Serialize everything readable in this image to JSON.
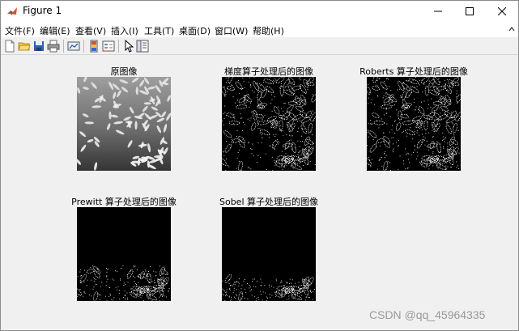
{
  "window": {
    "title": "Figure 1",
    "controls": {
      "minimize": "minimize",
      "maximize": "maximize",
      "close": "close"
    }
  },
  "menubar": {
    "items": [
      {
        "label": "文件(F)"
      },
      {
        "label": "编辑(E)"
      },
      {
        "label": "查看(V)"
      },
      {
        "label": "插入(I)"
      },
      {
        "label": "工具(T)"
      },
      {
        "label": "桌面(D)"
      },
      {
        "label": "窗口(W)"
      },
      {
        "label": "帮助(H)"
      }
    ]
  },
  "toolbar": {
    "buttons": [
      {
        "icon": "new-file-icon"
      },
      {
        "icon": "open-folder-icon"
      },
      {
        "icon": "save-icon"
      },
      {
        "icon": "print-icon"
      },
      {
        "icon": "link-plot-icon"
      },
      {
        "icon": "colorbar-icon"
      },
      {
        "icon": "legend-icon"
      },
      {
        "icon": "pointer-icon"
      },
      {
        "icon": "property-inspector-icon"
      }
    ]
  },
  "figure": {
    "panels": [
      {
        "title": "原图像",
        "image": "original rice image"
      },
      {
        "title": "梯度算子处理后的图像",
        "image": "gradient operator edges"
      },
      {
        "title": "Roberts 算子处理后的图像",
        "image": "roberts operator edges"
      },
      {
        "title": "Prewitt 算子处理后的图像",
        "image": "prewitt operator edges"
      },
      {
        "title": "Sobel 算子处理后的图像",
        "image": "sobel operator edges"
      }
    ]
  },
  "watermark": "CSDN @qq_45964335",
  "colors": {
    "window_bg": "#f0f0f0",
    "titlebar_bg": "#ffffff",
    "image_bg": "#000000",
    "watermark": "#9a9a9a"
  }
}
